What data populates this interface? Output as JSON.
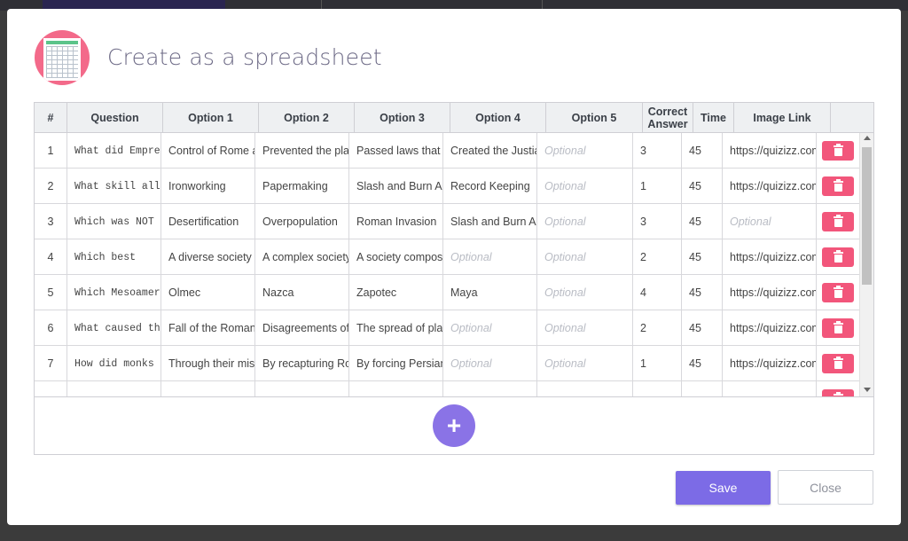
{
  "dialog": {
    "title": "Create as a spreadsheet",
    "icon": "spreadsheet-icon",
    "accent_color": "#7c6be6",
    "delete_color": "#f2567b"
  },
  "table": {
    "columns": [
      "#",
      "Question",
      "Option 1",
      "Option 2",
      "Option 3",
      "Option 4",
      "Option 5",
      "Correct Answer",
      "Time",
      "Image Link",
      ""
    ],
    "placeholder": "Optional",
    "rows": [
      {
        "num": "1",
        "question": "What did Empres",
        "opt1": "Control of Rome a",
        "opt2": "Prevented the plag",
        "opt3": "Passed laws that g",
        "opt4": "Created the Justiar",
        "opt5": "",
        "correct": "3",
        "time": "45",
        "image": "https://quizizz.com"
      },
      {
        "num": "2",
        "question": "What skill allo",
        "opt1": "Ironworking",
        "opt2": "Papermaking",
        "opt3": "Slash and Burn Ag",
        "opt4": "Record Keeping",
        "opt5": "",
        "correct": "1",
        "time": "45",
        "image": "https://quizizz.com"
      },
      {
        "num": "3",
        "question": "Which was NOT a",
        "opt1": "Desertification",
        "opt2": "Overpopulation",
        "opt3": "Roman Invasion",
        "opt4": "Slash and Burn Ag",
        "opt5": "",
        "correct": "3",
        "time": "45",
        "image": ""
      },
      {
        "num": "4",
        "question": "Which best",
        "opt1": "A diverse society u",
        "opt2": "A complex society",
        "opt3": "A society compose",
        "opt4": "",
        "opt5": "",
        "correct": "2",
        "time": "45",
        "image": "https://quizizz.com"
      },
      {
        "num": "5",
        "question": "Which Mesoameri",
        "opt1": "Olmec",
        "opt2": "Nazca",
        "opt3": "Zapotec",
        "opt4": "Maya",
        "opt5": "",
        "correct": "4",
        "time": "45",
        "image": "https://quizizz.com"
      },
      {
        "num": "6",
        "question": "What caused the",
        "opt1": "Fall  of the Roman",
        "opt2": "Disagreements of I",
        "opt3": "The spread of plag",
        "opt4": "",
        "opt5": "",
        "correct": "2",
        "time": "45",
        "image": "https://quizizz.com"
      },
      {
        "num": "7",
        "question": "How did monks h",
        "opt1": "Through their miss",
        "opt2": "By recapturing Ror",
        "opt3": "By forcing Persians",
        "opt4": "",
        "opt5": "",
        "correct": "1",
        "time": "45",
        "image": "https://quizizz.com"
      }
    ]
  },
  "add_row": {
    "label": "+"
  },
  "footer": {
    "save_label": "Save",
    "close_label": "Close"
  }
}
